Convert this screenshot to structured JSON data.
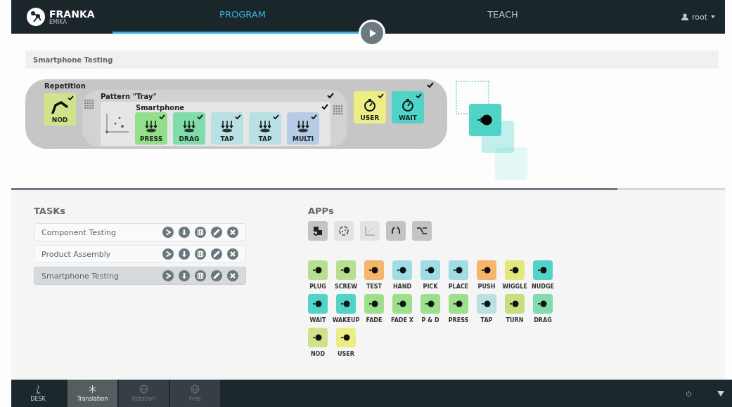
{
  "header": {
    "brand": "FRANKA",
    "brand_sub": "EMIKA",
    "tabs": [
      {
        "label": "PROGRAM",
        "selected": true
      },
      {
        "label": "TEACH",
        "selected": false
      }
    ],
    "user": "root"
  },
  "program": {
    "title": "Smartphone Testing",
    "repetition": {
      "label": "Repetition",
      "done": true,
      "apps": [
        {
          "label": "NOD",
          "color": "#cfe38a",
          "done": true
        }
      ],
      "pattern": {
        "label": "Pattern \"Tray\"",
        "done": true,
        "group": {
          "label": "Smartphone",
          "done": true,
          "apps": [
            {
              "label": "PRESS",
              "color": "#93e08a",
              "done": true
            },
            {
              "label": "DRAG",
              "color": "#7fdcab",
              "done": true
            },
            {
              "label": "TAP",
              "color": "#b9e1e4",
              "done": true
            },
            {
              "label": "TAP",
              "color": "#b9e1e4",
              "done": true
            },
            {
              "label": "MULTI",
              "color": "#b6cbe4",
              "done": true
            }
          ]
        }
      },
      "apps_after": [
        {
          "label": "USER",
          "color": "#ecee84",
          "done": true
        },
        {
          "label": "WAIT",
          "color": "#4fd4c8",
          "done": true
        }
      ]
    }
  },
  "tasks": {
    "title": "TASKs",
    "items": [
      {
        "name": "Component Testing",
        "selected": false
      },
      {
        "name": "Product Assembly",
        "selected": false
      },
      {
        "name": "Smartphone Testing",
        "selected": true
      }
    ]
  },
  "apps": {
    "title": "APPs",
    "groups": [
      {
        "disabled": false
      },
      {
        "disabled": true
      },
      {
        "disabled": true
      },
      {
        "disabled": false
      },
      {
        "disabled": false
      }
    ],
    "items": [
      {
        "label": "PLUG",
        "color": "#b7e08c"
      },
      {
        "label": "SCREW",
        "color": "#b7e08c"
      },
      {
        "label": "TEST",
        "color": "#f7b567"
      },
      {
        "label": "HAND",
        "color": "#9edde3"
      },
      {
        "label": "PICK",
        "color": "#9edde3"
      },
      {
        "label": "PLACE",
        "color": "#9edde3"
      },
      {
        "label": "PUSH",
        "color": "#f7b567"
      },
      {
        "label": "WIGGLE",
        "color": "#e4e879"
      },
      {
        "label": "NUDGE",
        "color": "#4fd4c8"
      },
      {
        "label": "WAIT",
        "color": "#4fd4c8"
      },
      {
        "label": "WAKEUP",
        "color": "#4fd4c8"
      },
      {
        "label": "FADE",
        "color": "#9de08a"
      },
      {
        "label": "FADE X",
        "color": "#9de08a"
      },
      {
        "label": "P & D",
        "color": "#9de08a"
      },
      {
        "label": "PRESS",
        "color": "#9de08a"
      },
      {
        "label": "TAP",
        "color": "#b9e1e4"
      },
      {
        "label": "TURN",
        "color": "#c8e07c"
      },
      {
        "label": "DRAG",
        "color": "#7fdcab"
      },
      {
        "label": "NOD",
        "color": "#cfe38a"
      },
      {
        "label": "USER",
        "color": "#ecee84"
      }
    ]
  },
  "bottom_bar": {
    "modes": [
      {
        "label": "DESK",
        "selected": false,
        "disabled": false
      },
      {
        "label": "Translation",
        "selected": true,
        "disabled": false
      },
      {
        "label": "Rotation",
        "selected": false,
        "disabled": true
      },
      {
        "label": "Free",
        "selected": false,
        "disabled": true
      }
    ]
  }
}
